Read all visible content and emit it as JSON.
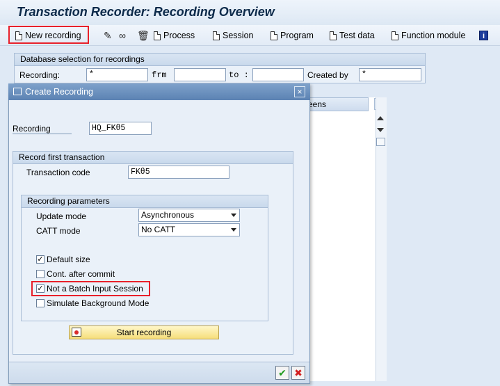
{
  "window": {
    "title": "Transaction Recorder: Recording Overview"
  },
  "toolbar": {
    "new_recording": "New recording",
    "process": "Process",
    "session": "Session",
    "program": "Program",
    "test_data": "Test data",
    "function_module": "Function module",
    "info_icon": "i"
  },
  "selection": {
    "title": "Database selection for recordings",
    "recording_label": "Recording:",
    "recording_value": "*",
    "from_label": "frm",
    "to_label": "to :",
    "created_by_label": "Created by",
    "created_by_value": "*"
  },
  "grid": {
    "column_header": "eens"
  },
  "dialog": {
    "title": "Create Recording",
    "close": "×",
    "recording_label": "Recording",
    "recording_value": "HQ_FKθ5",
    "first_tx": {
      "title": "Record first transaction",
      "tcode_label": "Transaction code",
      "tcode_value": "FKθ5"
    },
    "params": {
      "title": "Recording parameters",
      "update_mode_label": "Update mode",
      "update_mode_value": "Asynchronous",
      "catt_mode_label": "CATT mode",
      "catt_mode_value": "No CATT",
      "options": [
        {
          "label": "Default size",
          "checked": true
        },
        {
          "label": "Cont. after commit",
          "checked": false
        },
        {
          "label": "Not a Batch Input Session",
          "checked": true
        },
        {
          "label": "Simulate Background Mode",
          "checked": false
        }
      ]
    },
    "start_button": "Start recording",
    "confirm": "✔",
    "cancel": "✖"
  },
  "colors": {
    "highlight": "#e8202a",
    "dialog_title": "#5b82b3",
    "start_button": "#f6de7a"
  }
}
